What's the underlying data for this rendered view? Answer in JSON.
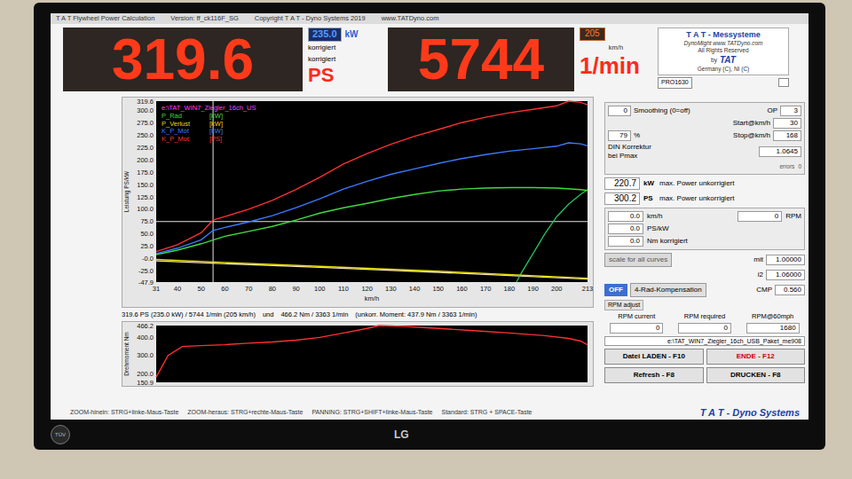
{
  "window": {
    "title": "T A T Flywheel Power Calculation",
    "version": "Version: ff_ck116F_SG",
    "copyright": "Copyright T A T - Dyno Systems 2019",
    "website": "www.TATDyno.com"
  },
  "display": {
    "power": "319.6",
    "kw": "235.0",
    "kw_unit": "kW",
    "corr1": "korrigiert",
    "corr2": "korrigiert",
    "ps_unit": "PS",
    "rpm": "5744",
    "speed": "205",
    "speed_unit": "km/h",
    "rpm_unit": "1/min"
  },
  "logo": {
    "title": "T A T - Messysteme",
    "line1": "DynoMight www.TATDyno.com",
    "line2": "All Rights Reserved",
    "by": "by",
    "brand": "TAT",
    "line3": "Germany (C), NI (C)",
    "model": "PRO1630"
  },
  "power_chart": {
    "y_label": "Leistung PS/kW",
    "x_label": "km/h",
    "y_min": -47.9,
    "y_max": 319.6,
    "x_min": 31,
    "x_max": 213,
    "y_ticks": [
      "319.6",
      "300.0",
      "275.0",
      "250.0",
      "225.0",
      "200.0",
      "175.0",
      "150.0",
      "125.0",
      "100.0",
      "75.0",
      "50.0",
      "25.0",
      "-0.0",
      "-25.0",
      "-47.9"
    ],
    "x_ticks": [
      "31",
      "40",
      "50",
      "60",
      "70",
      "80",
      "90",
      "100",
      "110",
      "120",
      "130",
      "140",
      "150",
      "160",
      "170",
      "180",
      "190",
      "200",
      "213"
    ],
    "file": {
      "label": "e:\\TAT_WIN7_Ziegler_16ch_US",
      "color": "#ff40ff"
    },
    "cursor": {
      "x": 55,
      "y": 75
    },
    "series": [
      {
        "label": "P_Rad",
        "unit": "[kW]",
        "color": "#3ddc3d",
        "points": [
          [
            31,
            8
          ],
          [
            40,
            17
          ],
          [
            50,
            30
          ],
          [
            60,
            45
          ],
          [
            70,
            55
          ],
          [
            80,
            65
          ],
          [
            90,
            78
          ],
          [
            100,
            92
          ],
          [
            110,
            103
          ],
          [
            120,
            112
          ],
          [
            130,
            122
          ],
          [
            140,
            130
          ],
          [
            150,
            137
          ],
          [
            160,
            141
          ],
          [
            170,
            143
          ],
          [
            180,
            144
          ],
          [
            190,
            144
          ],
          [
            200,
            143
          ],
          [
            210,
            140
          ],
          [
            213,
            138
          ]
        ]
      },
      {
        "label": "P_Verlust",
        "unit": "[kW]",
        "color": "#e6d800",
        "points": [
          [
            31,
            -2
          ],
          [
            60,
            -8
          ],
          [
            100,
            -16
          ],
          [
            150,
            -26
          ],
          [
            213,
            -40
          ]
        ]
      },
      {
        "label": "K_P_Mot",
        "unit": "[kW]",
        "color": "#3a7bff",
        "points": [
          [
            31,
            10
          ],
          [
            40,
            21
          ],
          [
            50,
            38
          ],
          [
            55,
            57
          ],
          [
            60,
            63
          ],
          [
            70,
            74
          ],
          [
            80,
            87
          ],
          [
            90,
            103
          ],
          [
            100,
            121
          ],
          [
            110,
            141
          ],
          [
            120,
            157
          ],
          [
            130,
            171
          ],
          [
            140,
            182
          ],
          [
            150,
            193
          ],
          [
            160,
            203
          ],
          [
            170,
            211
          ],
          [
            180,
            218
          ],
          [
            190,
            223
          ],
          [
            200,
            228
          ],
          [
            205,
            235
          ],
          [
            210,
            233
          ],
          [
            213,
            229
          ]
        ]
      },
      {
        "label": "K_P_Mot",
        "unit": "[PS]",
        "color": "#ff3030",
        "points": [
          [
            31,
            14
          ],
          [
            40,
            28
          ],
          [
            50,
            52
          ],
          [
            55,
            78
          ],
          [
            60,
            85
          ],
          [
            70,
            100
          ],
          [
            80,
            118
          ],
          [
            90,
            140
          ],
          [
            100,
            165
          ],
          [
            110,
            192
          ],
          [
            120,
            213
          ],
          [
            130,
            232
          ],
          [
            140,
            248
          ],
          [
            150,
            262
          ],
          [
            160,
            276
          ],
          [
            170,
            287
          ],
          [
            180,
            296
          ],
          [
            190,
            303
          ],
          [
            200,
            310
          ],
          [
            205,
            319.6
          ],
          [
            210,
            317
          ],
          [
            213,
            312
          ]
        ]
      }
    ],
    "extra_lines": [
      {
        "color": "#f3e7bd",
        "points": [
          [
            31,
            -5
          ],
          [
            100,
            -18
          ],
          [
            150,
            -28
          ],
          [
            213,
            -42
          ]
        ]
      },
      {
        "color": "#22c55e",
        "points": [
          [
            183,
            -47.9
          ],
          [
            185,
            -30
          ],
          [
            190,
            10
          ],
          [
            195,
            50
          ],
          [
            200,
            85
          ],
          [
            205,
            110
          ],
          [
            210,
            130
          ],
          [
            213,
            140
          ]
        ]
      }
    ]
  },
  "readout": {
    "power": "319.6 PS (235.0 kW) / 5744 1/min (205 km/h)",
    "und": "und",
    "torque": "466.2 Nm / 3363 1/min",
    "uncorrected": "(unkorr. Moment: 437.9 Nm / 3363 1/min)"
  },
  "torque_chart": {
    "y_label": "Drehmoment Nm",
    "y_min": 150.9,
    "y_max": 466.2,
    "x_min": 31,
    "x_max": 213,
    "y_ticks": [
      "466.2",
      "400.0",
      "300.0",
      "200.0",
      "150.9"
    ],
    "series": [
      {
        "color": "#ff3030",
        "points": [
          [
            31,
            180
          ],
          [
            36,
            300
          ],
          [
            42,
            350
          ],
          [
            50,
            355
          ],
          [
            60,
            360
          ],
          [
            70,
            368
          ],
          [
            80,
            375
          ],
          [
            90,
            385
          ],
          [
            100,
            400
          ],
          [
            110,
            425
          ],
          [
            120,
            450
          ],
          [
            125,
            466.2
          ],
          [
            135,
            462
          ],
          [
            150,
            450
          ],
          [
            165,
            438
          ],
          [
            180,
            425
          ],
          [
            195,
            410
          ],
          [
            205,
            395
          ],
          [
            210,
            380
          ],
          [
            213,
            360
          ]
        ]
      }
    ]
  },
  "hints": [
    "ZOOM-hinein: STRG+linke-Maus-Taste",
    "ZOOM-heraus: STRG+rechte-Maus-Taste",
    "PANNING: STRG+SHIFT+linke-Maus-Taste",
    "Standard: STRG + SPACE-Taste"
  ],
  "footer_brand": "T A T - Dyno Systems",
  "settings": {
    "smoothing_value": "0",
    "smoothing_label": "Smoothing (0=off)",
    "op_label": "OP",
    "op_value": "3",
    "start_label": "Start@km/h",
    "start_value": "30",
    "percent": "79",
    "percent_unit": "%",
    "stop_label": "Stop@km/h",
    "stop_value": "168",
    "din_label1": "DIN Korrektur",
    "din_label2": "bei Pmax",
    "din_value": "1.0645",
    "errors_label": "errors",
    "errors_value": "0"
  },
  "max_power": [
    {
      "value": "220.7",
      "unit": "kW",
      "label": "max. Power unkorrigiert"
    },
    {
      "value": "300.2",
      "unit": "PS",
      "label": "max. Power unkorrigiert"
    }
  ],
  "cursor_readout": {
    "speed": "0.0",
    "speed_unit": "km/h",
    "rpm": "0",
    "rpm_unit": "RPM",
    "power": "0.0",
    "power_unit": "PS/kW",
    "torque": "0.0",
    "torque_unit": "Nm korrigiert"
  },
  "scale": {
    "button": "scale for all curves",
    "mit_label": "mit",
    "mit_value": "1.00000",
    "i2_label": "i2",
    "i2_value": "1.06000"
  },
  "compensation": {
    "toggle": "OFF",
    "on": false,
    "button": "4-Rad-Kompensation",
    "cmp_label": "CMP",
    "cmp_value": "0.560"
  },
  "rpm_adjust": {
    "title": "RPM adjust",
    "columns": [
      {
        "label": "RPM current",
        "value": "0"
      },
      {
        "label": "RPM required",
        "value": "0"
      },
      {
        "label": "RPM@60mph",
        "value": "1680"
      }
    ]
  },
  "file_path": "e:\\TAT_WIN7_Ziegler_16ch_USB_Paket_me908",
  "buttons": [
    {
      "label": "Datei LADEN - F10",
      "color": "#000000"
    },
    {
      "label": "ENDE - F12",
      "color": "#cc0000"
    },
    {
      "label": "Refresh - F8",
      "color": "#000000"
    },
    {
      "label": "DRUCKEN - F8",
      "color": "#000000"
    }
  ],
  "monitor": {
    "brand": "LG",
    "badge": "TÜV"
  }
}
